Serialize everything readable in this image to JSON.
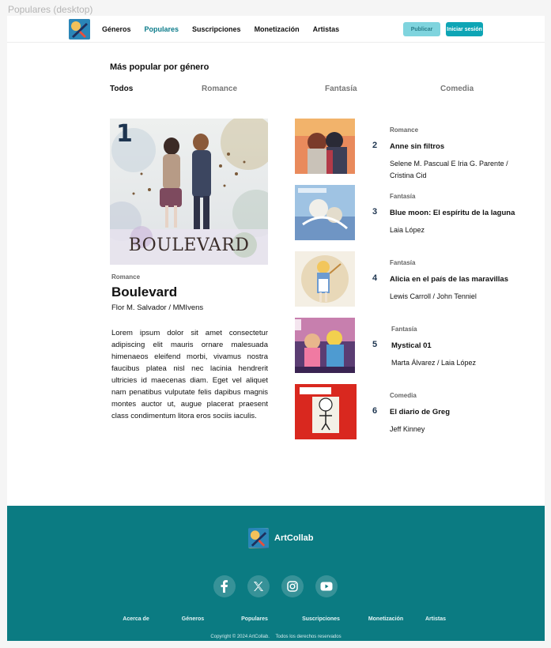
{
  "frame_label": "Populares (desktop)",
  "header": {
    "nav": [
      "Géneros",
      "Populares",
      "Suscripciones",
      "Monetización",
      "Artistas"
    ],
    "active_nav": "Populares",
    "publish_label": "Publicar",
    "login_label": "Iniciar sesión"
  },
  "section": {
    "title": "Más popular por género",
    "tabs": [
      "Todos",
      "Romance",
      "Fantasía",
      "Comedia"
    ],
    "active_tab": "Todos"
  },
  "featured": {
    "rank": "1",
    "cover_text": "BOULEVARD",
    "genre": "Romance",
    "title": "Boulevard",
    "authors": "Flor M. Salvador / MMIvens",
    "description": "Lorem ipsum dolor sit amet consectetur adipiscing elit mauris ornare malesuada himenaeos eleifend morbi, vivamus nostra faucibus platea nisl nec lacinia hendrerit ultricies id maecenas diam. Eget vel aliquet nam penatibus vulputate felis dapibus magnis montes auctor ut, augue placerat praesent class condimentum litora eros sociis iaculis."
  },
  "list": [
    {
      "rank": "2",
      "genre": "Romance",
      "title": "Anne sin filtros",
      "authors": "Selene M. Pascual E Iria G. Parente / Cristina Cid"
    },
    {
      "rank": "3",
      "genre": "Fantasía",
      "title": "Blue moon: El espíritu de la laguna",
      "authors": "Laia López"
    },
    {
      "rank": "4",
      "genre": "Fantasía",
      "title": "Alicia en el país de las maravillas",
      "authors": "Lewis Carroll / John Tenniel"
    },
    {
      "rank": "5",
      "genre": "Fantasía",
      "title": "Mystical 01",
      "authors": "Marta Álvarez / Laia López"
    },
    {
      "rank": "6",
      "genre": "Comedia",
      "title": "El diario de Greg",
      "authors": "Jeff Kinney"
    }
  ],
  "footer": {
    "brand": "ArtCollab",
    "socials": [
      "facebook-icon",
      "x-icon",
      "instagram-icon",
      "youtube-icon"
    ],
    "links": [
      "Acerca de",
      "Géneros",
      "Populares",
      "Suscripciones",
      "Monetización",
      "Artistas"
    ],
    "copyright": "Copyright © 2024 ArtCollab.",
    "rights": "Todos los derechos reservados"
  },
  "colors": {
    "accent": "#0b7b8a",
    "footer_bg": "#0b7b82",
    "login_button": "#0ea5b5",
    "publish_button": "#7fd4de",
    "rank_color": "#1e3550"
  }
}
